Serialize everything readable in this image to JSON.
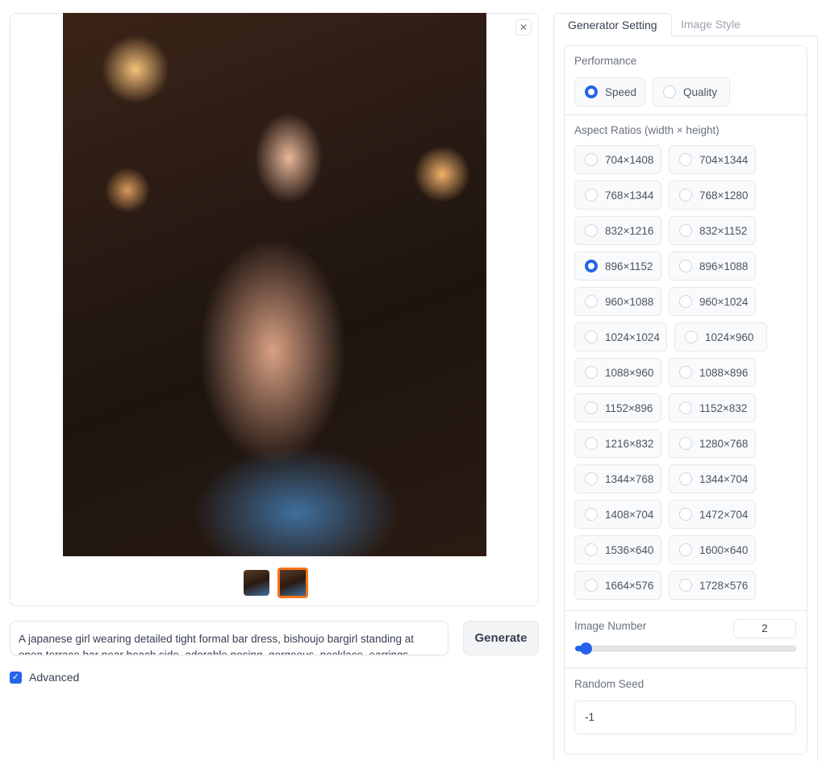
{
  "gallery": {
    "close_icon": "close-icon",
    "thumbnails": 2,
    "selected_thumbnail": 2
  },
  "prompt": {
    "value": "A japanese girl wearing detailed tight formal bar dress, bishoujo bargirl standing at open terrace bar near beach side, adorable posing, gorgeous, necklace, earrings"
  },
  "generate_label": "Generate",
  "advanced": {
    "label": "Advanced",
    "checked": true
  },
  "tabs": [
    {
      "label": "Generator Setting",
      "active": true
    },
    {
      "label": "Image Style",
      "active": false
    }
  ],
  "performance": {
    "label": "Performance",
    "options": [
      "Speed",
      "Quality"
    ],
    "selected": "Speed"
  },
  "aspect": {
    "label": "Aspect Ratios (width × height)",
    "selected": "896×1152",
    "options": [
      "704×1408",
      "704×1344",
      "768×1344",
      "768×1280",
      "832×1216",
      "832×1152",
      "896×1152",
      "896×1088",
      "960×1088",
      "960×1024",
      "1024×1024",
      "1024×960",
      "1088×960",
      "1088×896",
      "1152×896",
      "1152×832",
      "1216×832",
      "1280×768",
      "1344×768",
      "1344×704",
      "1408×704",
      "1472×704",
      "1536×640",
      "1600×640",
      "1664×576",
      "1728×576"
    ]
  },
  "image_number": {
    "label": "Image Number",
    "value": "2"
  },
  "seed": {
    "label": "Random Seed",
    "value": "-1"
  },
  "colors": {
    "accent": "#2563eb",
    "selected_thumb": "#f97316"
  }
}
